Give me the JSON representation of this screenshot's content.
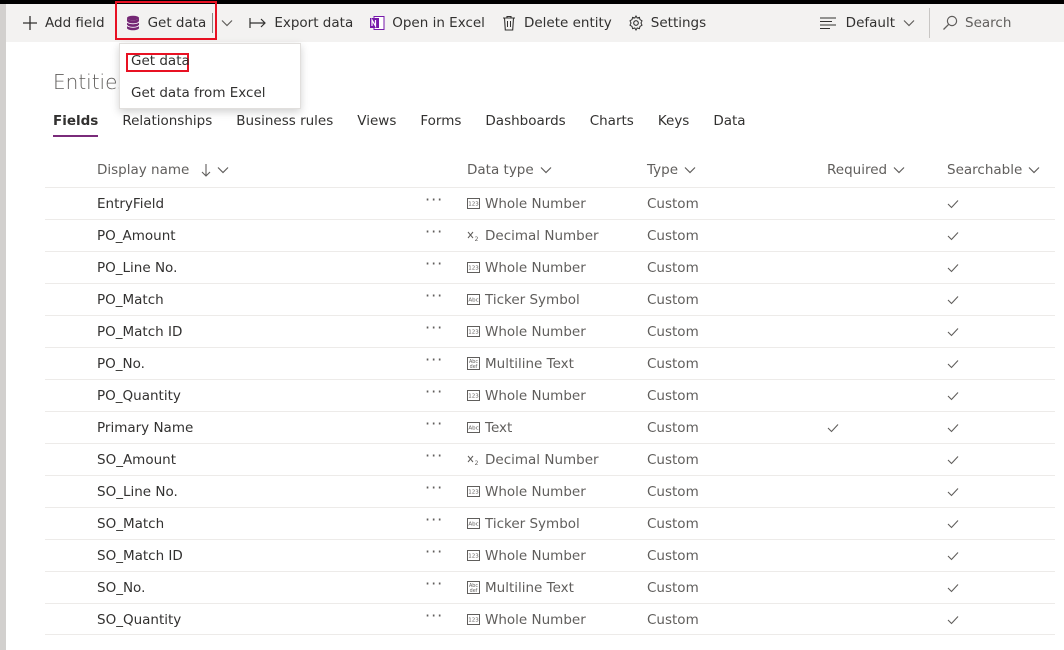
{
  "toolbar": {
    "add_field": "Add field",
    "get_data": "Get data",
    "export_data": "Export data",
    "open_in_excel": "Open in Excel",
    "delete_entity": "Delete entity",
    "settings": "Settings",
    "view_selector": "Default",
    "search_placeholder": "Search"
  },
  "get_data_menu": {
    "items": [
      "Get data",
      "Get data from Excel"
    ]
  },
  "page": {
    "title": "Entities"
  },
  "tabs": [
    "Fields",
    "Relationships",
    "Business rules",
    "Views",
    "Forms",
    "Dashboards",
    "Charts",
    "Keys",
    "Data"
  ],
  "columns": {
    "display_name": "Display name",
    "data_type": "Data type",
    "type": "Type",
    "required": "Required",
    "searchable": "Searchable"
  },
  "rows": [
    {
      "name": "EntryField",
      "data_type": "Whole Number",
      "icon": "whole-number-icon",
      "type": "Custom",
      "required": false,
      "searchable": true
    },
    {
      "name": "PO_Amount",
      "data_type": "Decimal Number",
      "icon": "decimal-number-icon",
      "type": "Custom",
      "required": false,
      "searchable": true
    },
    {
      "name": "PO_Line No.",
      "data_type": "Whole Number",
      "icon": "whole-number-icon",
      "type": "Custom",
      "required": false,
      "searchable": true
    },
    {
      "name": "PO_Match",
      "data_type": "Ticker Symbol",
      "icon": "ticker-symbol-icon",
      "type": "Custom",
      "required": false,
      "searchable": true
    },
    {
      "name": "PO_Match ID",
      "data_type": "Whole Number",
      "icon": "whole-number-icon",
      "type": "Custom",
      "required": false,
      "searchable": true
    },
    {
      "name": "PO_No.",
      "data_type": "Multiline Text",
      "icon": "multiline-text-icon",
      "type": "Custom",
      "required": false,
      "searchable": true
    },
    {
      "name": "PO_Quantity",
      "data_type": "Whole Number",
      "icon": "whole-number-icon",
      "type": "Custom",
      "required": false,
      "searchable": true
    },
    {
      "name": "Primary Name",
      "data_type": "Text",
      "icon": "text-icon",
      "type": "Custom",
      "required": true,
      "searchable": true
    },
    {
      "name": "SO_Amount",
      "data_type": "Decimal Number",
      "icon": "decimal-number-icon",
      "type": "Custom",
      "required": false,
      "searchable": true
    },
    {
      "name": "SO_Line No.",
      "data_type": "Whole Number",
      "icon": "whole-number-icon",
      "type": "Custom",
      "required": false,
      "searchable": true
    },
    {
      "name": "SO_Match",
      "data_type": "Ticker Symbol",
      "icon": "ticker-symbol-icon",
      "type": "Custom",
      "required": false,
      "searchable": true
    },
    {
      "name": "SO_Match ID",
      "data_type": "Whole Number",
      "icon": "whole-number-icon",
      "type": "Custom",
      "required": false,
      "searchable": true
    },
    {
      "name": "SO_No.",
      "data_type": "Multiline Text",
      "icon": "multiline-text-icon",
      "type": "Custom",
      "required": false,
      "searchable": true
    },
    {
      "name": "SO_Quantity",
      "data_type": "Whole Number",
      "icon": "whole-number-icon",
      "type": "Custom",
      "required": false,
      "searchable": true
    }
  ],
  "colors": {
    "highlight": "#e81123",
    "active_tab": "#7a2b7a",
    "toolbar_bg": "#f3f2f1"
  }
}
